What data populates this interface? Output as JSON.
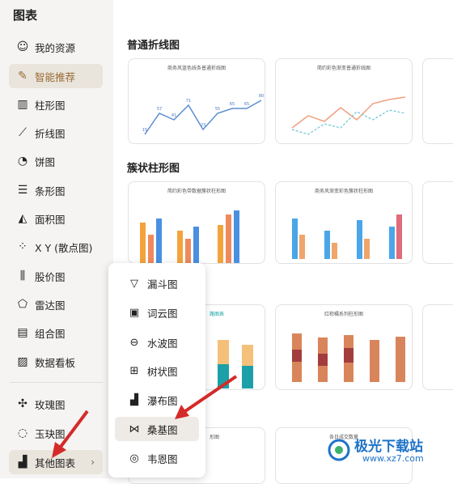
{
  "sidebar": {
    "title": "图表",
    "items": [
      {
        "label": "我的资源",
        "icon": "user-icon"
      },
      {
        "label": "智能推荐",
        "icon": "brush-icon",
        "active": true
      },
      {
        "label": "柱形图",
        "icon": "bar-chart-icon"
      },
      {
        "label": "折线图",
        "icon": "line-chart-icon"
      },
      {
        "label": "饼图",
        "icon": "pie-chart-icon"
      },
      {
        "label": "条形图",
        "icon": "hbar-chart-icon"
      },
      {
        "label": "面积图",
        "icon": "area-chart-icon"
      },
      {
        "label": "X Y (散点图)",
        "icon": "scatter-chart-icon"
      },
      {
        "label": "股价图",
        "icon": "stock-chart-icon"
      },
      {
        "label": "雷达图",
        "icon": "radar-chart-icon"
      },
      {
        "label": "组合图",
        "icon": "combo-chart-icon"
      },
      {
        "label": "数据看板",
        "icon": "dashboard-icon"
      },
      {
        "label": "玫瑰图",
        "icon": "rose-chart-icon"
      },
      {
        "label": "玉玦图",
        "icon": "ring-chart-icon"
      },
      {
        "label": "其他图表",
        "icon": "other-chart-icon"
      }
    ]
  },
  "main": {
    "sections": [
      {
        "title": "普通折线图"
      },
      {
        "title": "簇状柱形图"
      }
    ],
    "cards": [
      {
        "title": "商务风蓝色线条普通折线图"
      },
      {
        "title": "简约彩色渐变普通折线图"
      },
      {
        "title": "简约彩色带数据簇状柱形图"
      },
      {
        "title": "商务风渐变彩色簇状柱形图"
      },
      {
        "title": "路图表"
      },
      {
        "title": "红棕橘系列柱形图"
      },
      {
        "title": "形图"
      },
      {
        "title": "各日成交数量"
      }
    ],
    "line_points": [
      "15",
      "57",
      "41",
      "71",
      "23",
      "55",
      "65",
      "65",
      "80"
    ],
    "month_labels": [
      "一月",
      "二月",
      "三月",
      "四月",
      "五月",
      "六月",
      "七月",
      "八月"
    ]
  },
  "popup": {
    "items": [
      {
        "label": "漏斗图",
        "icon": "funnel-icon"
      },
      {
        "label": "词云图",
        "icon": "wordcloud-icon"
      },
      {
        "label": "水波图",
        "icon": "wave-icon"
      },
      {
        "label": "树状图",
        "icon": "treemap-icon"
      },
      {
        "label": "瀑布图",
        "icon": "waterfall-icon"
      },
      {
        "label": "桑基图",
        "icon": "sankey-icon",
        "highlighted": true
      },
      {
        "label": "韦恩图",
        "icon": "venn-icon"
      }
    ]
  },
  "watermark": {
    "text": "极光下载站",
    "url": "www.xz7.com"
  },
  "colors": {
    "accent": "#9a6b35",
    "arrow": "#d42a2a",
    "watermark": "#1e73c8"
  }
}
